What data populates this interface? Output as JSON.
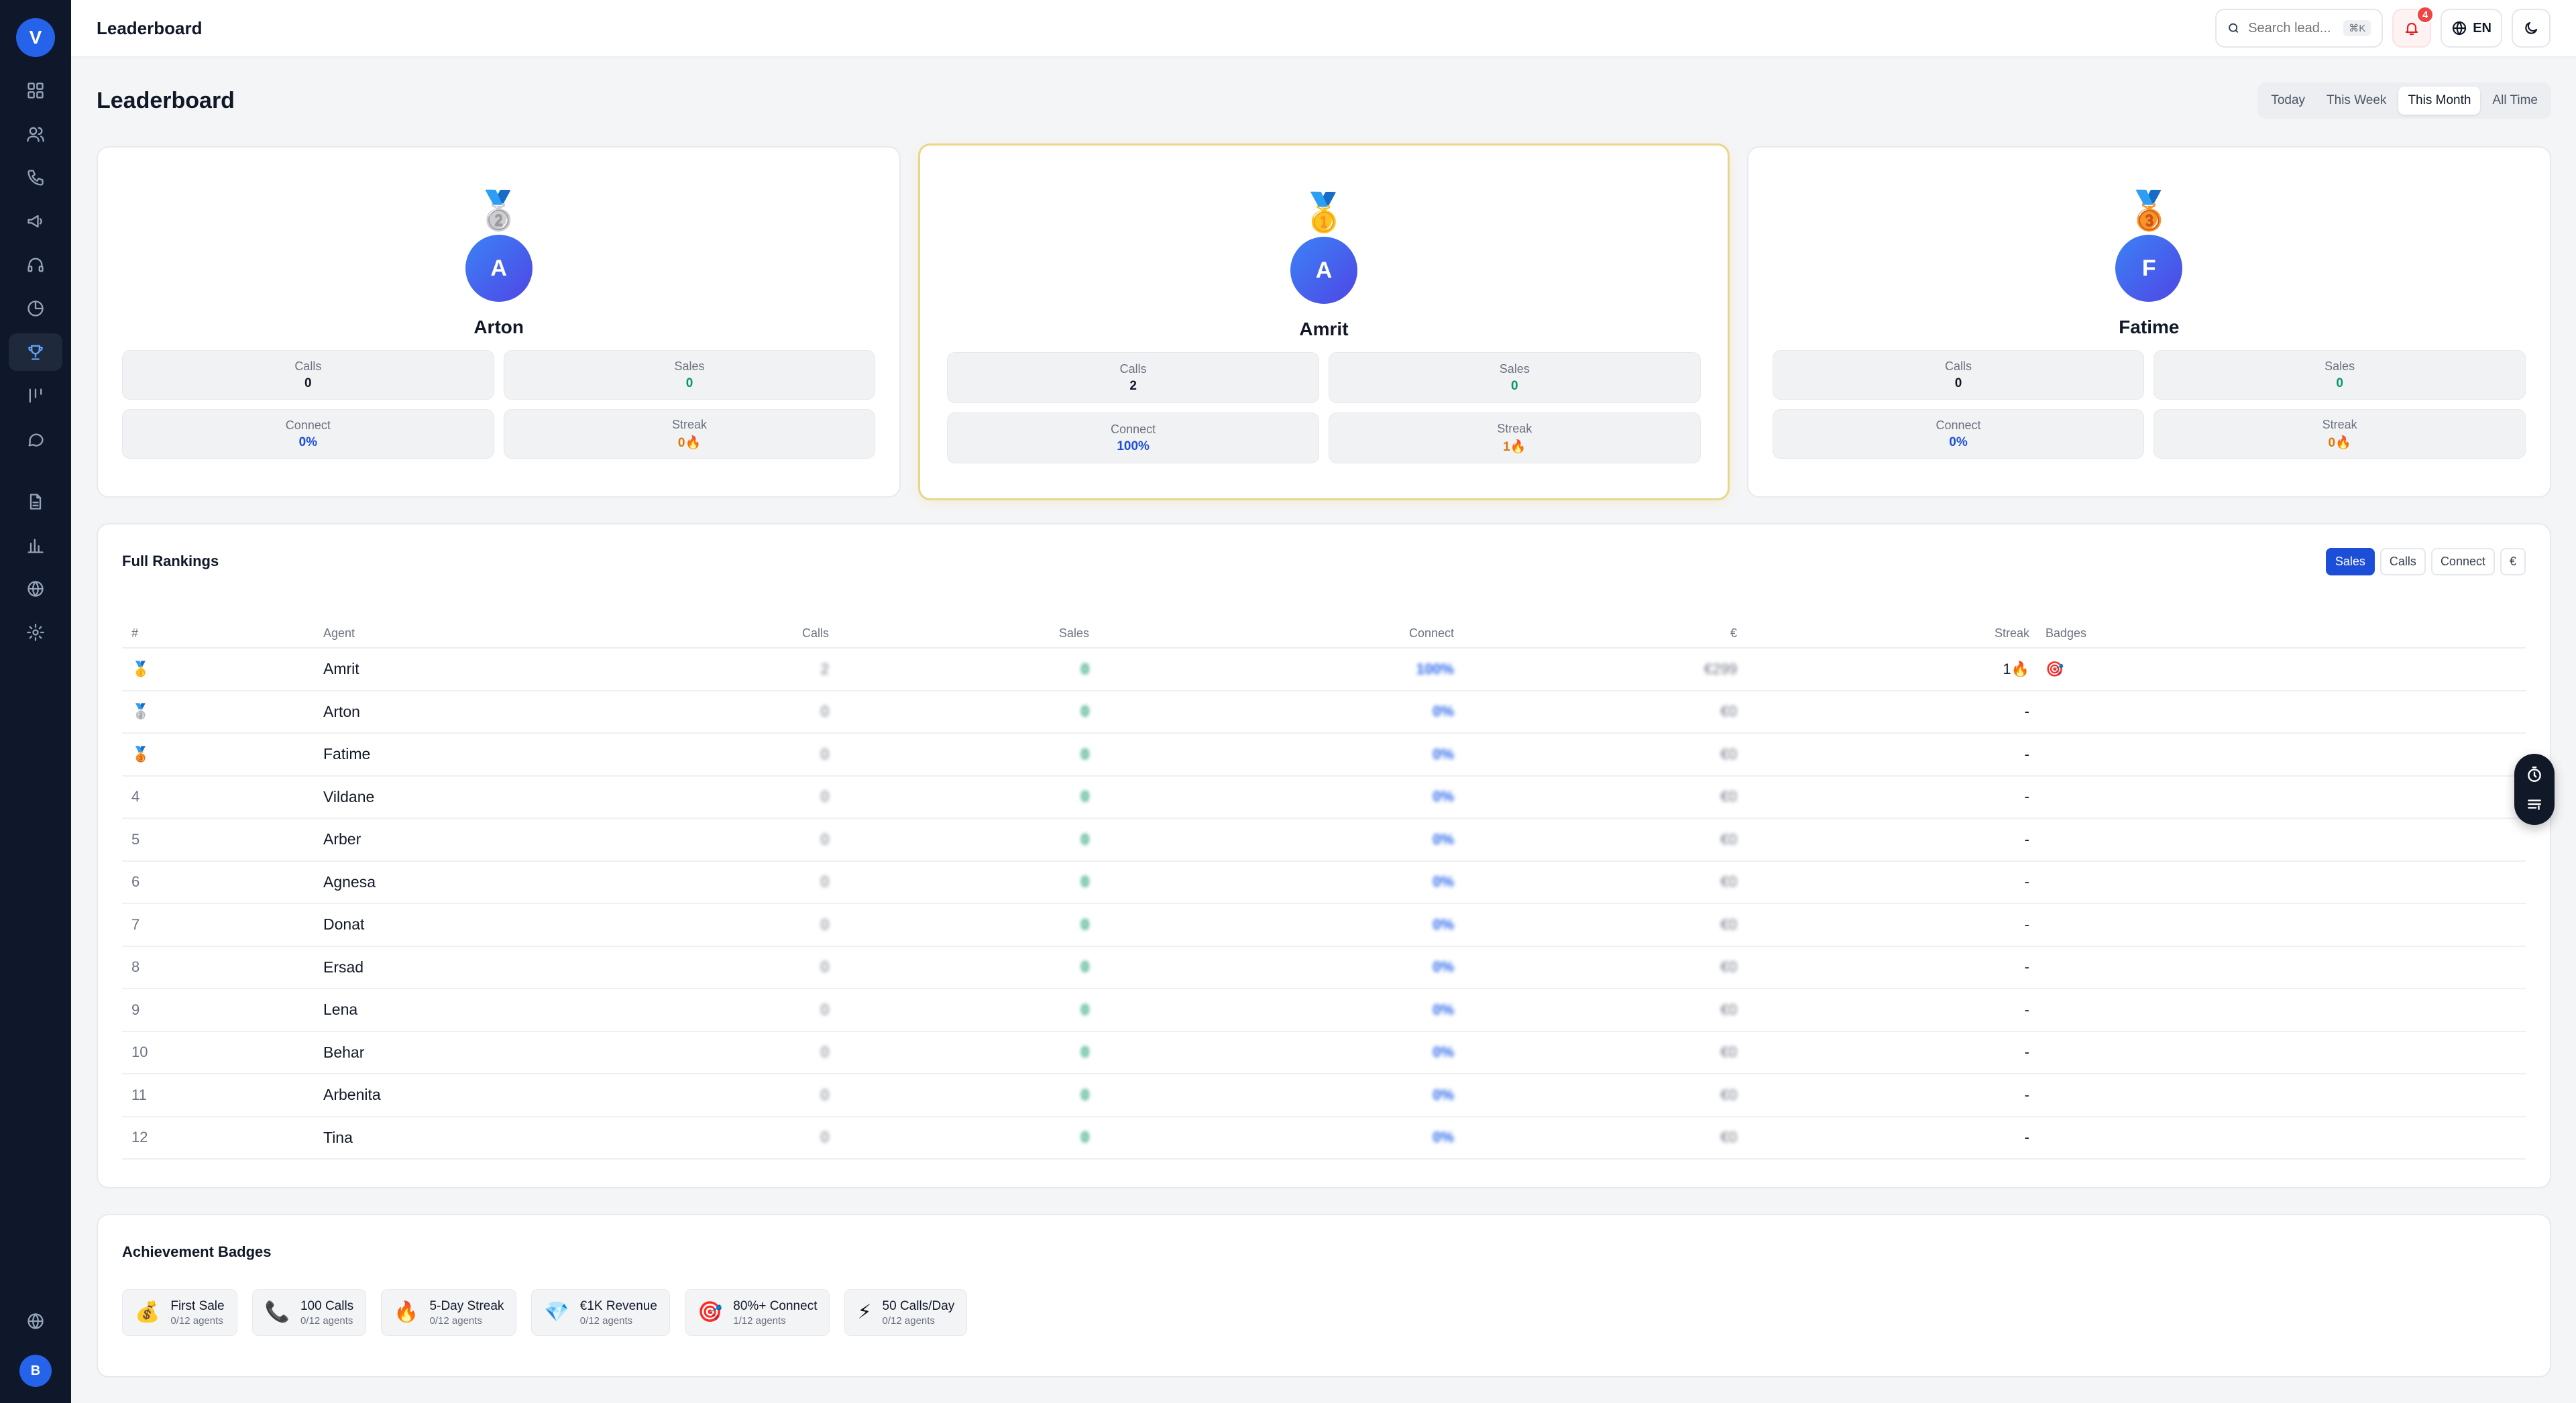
{
  "app": {
    "logo_letter": "V",
    "user_initial": "B"
  },
  "topbar": {
    "title": "Leaderboard",
    "search_placeholder": "Search lead...",
    "search_shortcut": "⌘K",
    "notification_count": "4",
    "language": "EN"
  },
  "page": {
    "title": "Leaderboard",
    "periods": [
      "Today",
      "This Week",
      "This Month",
      "All Time"
    ],
    "active_period": "This Month"
  },
  "podium": [
    {
      "place": 2,
      "medal": "🥈",
      "initial": "A",
      "name": "Arton",
      "stats": [
        {
          "label": "Calls",
          "value": "0"
        },
        {
          "label": "Sales",
          "value": "0"
        },
        {
          "label": "Connect",
          "value": "0%"
        },
        {
          "label": "Streak",
          "value": "0🔥"
        }
      ]
    },
    {
      "place": 1,
      "medal": "🥇",
      "initial": "A",
      "name": "Amrit",
      "stats": [
        {
          "label": "Calls",
          "value": "2"
        },
        {
          "label": "Sales",
          "value": "0"
        },
        {
          "label": "Connect",
          "value": "100%"
        },
        {
          "label": "Streak",
          "value": "1🔥"
        }
      ]
    },
    {
      "place": 3,
      "medal": "🥉",
      "initial": "F",
      "name": "Fatime",
      "stats": [
        {
          "label": "Calls",
          "value": "0"
        },
        {
          "label": "Sales",
          "value": "0"
        },
        {
          "label": "Connect",
          "value": "0%"
        },
        {
          "label": "Streak",
          "value": "0🔥"
        }
      ]
    }
  ],
  "rankings": {
    "title": "Full Rankings",
    "sort_options": [
      "Sales",
      "Calls",
      "Connect",
      "€"
    ],
    "active_sort": "Sales",
    "columns": [
      "#",
      "Agent",
      "Calls",
      "Sales",
      "Connect",
      "€",
      "Streak",
      "Badges"
    ],
    "rows": [
      {
        "rank": "🥇",
        "agent": "Amrit",
        "calls": "2",
        "sales": "0",
        "connect": "100%",
        "revenue": "€299",
        "streak": "1🔥",
        "badges": "🎯"
      },
      {
        "rank": "🥈",
        "agent": "Arton",
        "calls": "0",
        "sales": "0",
        "connect": "0%",
        "revenue": "€0",
        "streak": "-",
        "badges": ""
      },
      {
        "rank": "🥉",
        "agent": "Fatime",
        "calls": "0",
        "sales": "0",
        "connect": "0%",
        "revenue": "€0",
        "streak": "-",
        "badges": ""
      },
      {
        "rank": "4",
        "agent": "Vildane",
        "calls": "0",
        "sales": "0",
        "connect": "0%",
        "revenue": "€0",
        "streak": "-",
        "badges": ""
      },
      {
        "rank": "5",
        "agent": "Arber",
        "calls": "0",
        "sales": "0",
        "connect": "0%",
        "revenue": "€0",
        "streak": "-",
        "badges": ""
      },
      {
        "rank": "6",
        "agent": "Agnesa",
        "calls": "0",
        "sales": "0",
        "connect": "0%",
        "revenue": "€0",
        "streak": "-",
        "badges": ""
      },
      {
        "rank": "7",
        "agent": "Donat",
        "calls": "0",
        "sales": "0",
        "connect": "0%",
        "revenue": "€0",
        "streak": "-",
        "badges": ""
      },
      {
        "rank": "8",
        "agent": "Ersad",
        "calls": "0",
        "sales": "0",
        "connect": "0%",
        "revenue": "€0",
        "streak": "-",
        "badges": ""
      },
      {
        "rank": "9",
        "agent": "Lena",
        "calls": "0",
        "sales": "0",
        "connect": "0%",
        "revenue": "€0",
        "streak": "-",
        "badges": ""
      },
      {
        "rank": "10",
        "agent": "Behar",
        "calls": "0",
        "sales": "0",
        "connect": "0%",
        "revenue": "€0",
        "streak": "-",
        "badges": ""
      },
      {
        "rank": "11",
        "agent": "Arbenita",
        "calls": "0",
        "sales": "0",
        "connect": "0%",
        "revenue": "€0",
        "streak": "-",
        "badges": ""
      },
      {
        "rank": "12",
        "agent": "Tina",
        "calls": "0",
        "sales": "0",
        "connect": "0%",
        "revenue": "€0",
        "streak": "-",
        "badges": ""
      }
    ]
  },
  "achievements": {
    "title": "Achievement Badges",
    "items": [
      {
        "icon": "💰",
        "name": "First Sale",
        "count": "0/12 agents"
      },
      {
        "icon": "📞",
        "name": "100 Calls",
        "count": "0/12 agents"
      },
      {
        "icon": "🔥",
        "name": "5-Day Streak",
        "count": "0/12 agents"
      },
      {
        "icon": "💎",
        "name": "€1K Revenue",
        "count": "0/12 agents"
      },
      {
        "icon": "🎯",
        "name": "80%+ Connect",
        "count": "1/12 agents"
      },
      {
        "icon": "⚡",
        "name": "50 Calls/Day",
        "count": "0/12 agents"
      }
    ]
  }
}
